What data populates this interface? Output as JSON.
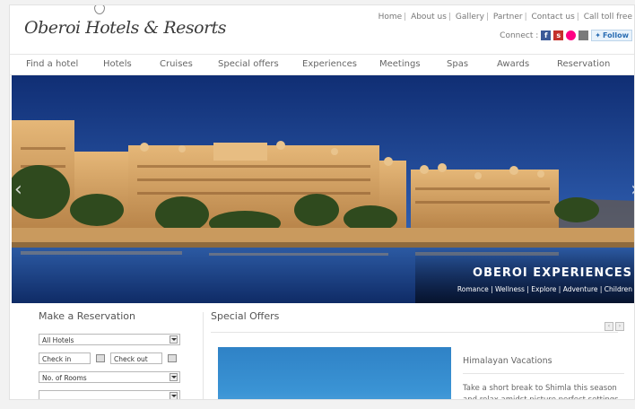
{
  "header": {
    "brand": "Oberoi Hotels & Resorts",
    "top_links": [
      "Home",
      "About us",
      "Gallery",
      "Partner",
      "Contact us",
      "Call toll free"
    ],
    "connect_label": "Connect :",
    "social_icons": [
      "facebook-icon",
      "stumbleupon-icon",
      "flickr-icon",
      "myspace-icon"
    ],
    "follow_label": "Follow"
  },
  "nav": {
    "items": [
      "Find a hotel",
      "Hotels",
      "Cruises",
      "Special offers",
      "Experiences",
      "Meetings",
      "Spas",
      "Awards",
      "Reservation"
    ]
  },
  "hero": {
    "title": "OBEROI EXPERIENCES",
    "links": "Romance | Wellness | Explore | Adventure | Children",
    "prev_arrow": "‹",
    "next_arrow": "›"
  },
  "reservation": {
    "heading": "Make a Reservation",
    "hotel_select": "All Hotels",
    "check_in": "Check in",
    "check_out": "Check out",
    "rooms_select": "No. of Rooms"
  },
  "offers": {
    "heading": "Special Offers",
    "pager_prev": "‹",
    "pager_next": "›",
    "item_title": "Himalayan Vacations",
    "item_desc": "Take a short break to Shimla this season and relax amidst picture perfect settings"
  },
  "colors": {
    "sky": "#1b3f86",
    "palace": "#d9a461",
    "facebook": "#3b5998"
  }
}
